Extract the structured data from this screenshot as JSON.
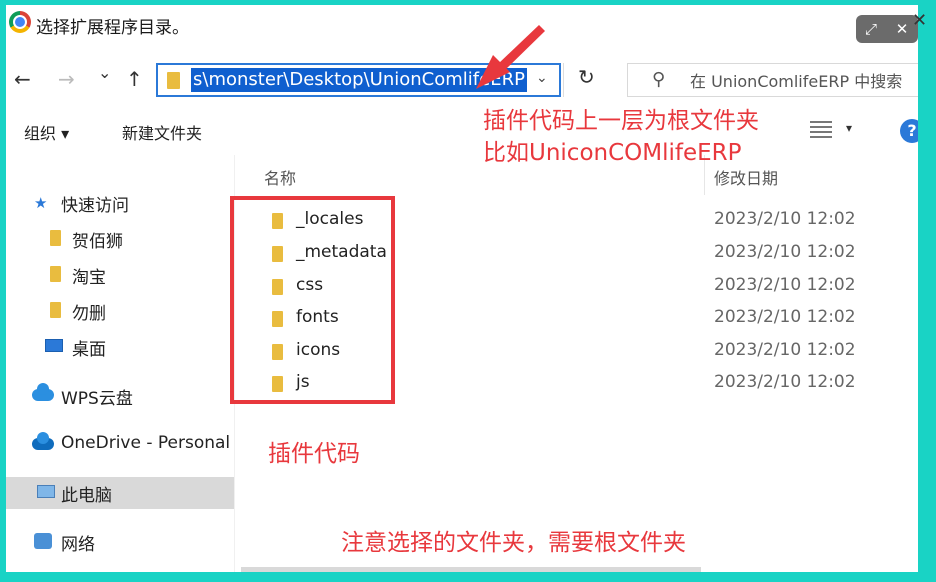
{
  "window": {
    "title": "选择扩展程序目录。"
  },
  "titlebar_buttons": {
    "expand": "⤢",
    "close": "✕",
    "edge_close": "✕"
  },
  "nav": {
    "back": "←",
    "forward": "→",
    "recent": "⌄",
    "up": "↑",
    "address_path": "s\\monster\\Desktop\\UnionComlifeERP",
    "address_dropdown": "⌄",
    "refresh": "↻",
    "search_placeholder": "在 UnionComlifeERP 中搜索"
  },
  "toolbar": {
    "organize": "组织 ▾",
    "new_folder": "新建文件夹",
    "view_dropdown": "▾",
    "help": "?"
  },
  "sidebar": {
    "items": [
      {
        "label": "快速访问",
        "icon": "star-icon"
      },
      {
        "label": "贺佰狮",
        "icon": "folder-icon"
      },
      {
        "label": "淘宝",
        "icon": "folder-icon"
      },
      {
        "label": "勿删",
        "icon": "folder-icon"
      },
      {
        "label": "桌面",
        "icon": "desktop-icon"
      },
      {
        "label": "WPS云盘",
        "icon": "cloud-icon"
      },
      {
        "label": "OneDrive - Personal",
        "icon": "onedrive-icon"
      },
      {
        "label": "此电脑",
        "icon": "pc-icon"
      },
      {
        "label": "网络",
        "icon": "network-icon"
      }
    ]
  },
  "file_list": {
    "columns": [
      "名称",
      "修改日期"
    ],
    "rows": [
      {
        "name": "_locales",
        "modified": "2023/2/10 12:02"
      },
      {
        "name": "_metadata",
        "modified": "2023/2/10 12:02"
      },
      {
        "name": "css",
        "modified": "2023/2/10 12:02"
      },
      {
        "name": "fonts",
        "modified": "2023/2/10 12:02"
      },
      {
        "name": "icons",
        "modified": "2023/2/10 12:02"
      },
      {
        "name": "js",
        "modified": "2023/2/10 12:02"
      }
    ]
  },
  "annotations": {
    "line1": "插件代码上一层为根文件夹",
    "line2": "比如UniconCOMlifeERP",
    "plugin_code": "插件代码",
    "note": "注意选择的文件夹，需要根文件夹"
  },
  "colors": {
    "frame": "#19d3c5",
    "annotation": "#e8383d",
    "selection": "#0f5fcf",
    "folder": "#e9bc3f"
  }
}
